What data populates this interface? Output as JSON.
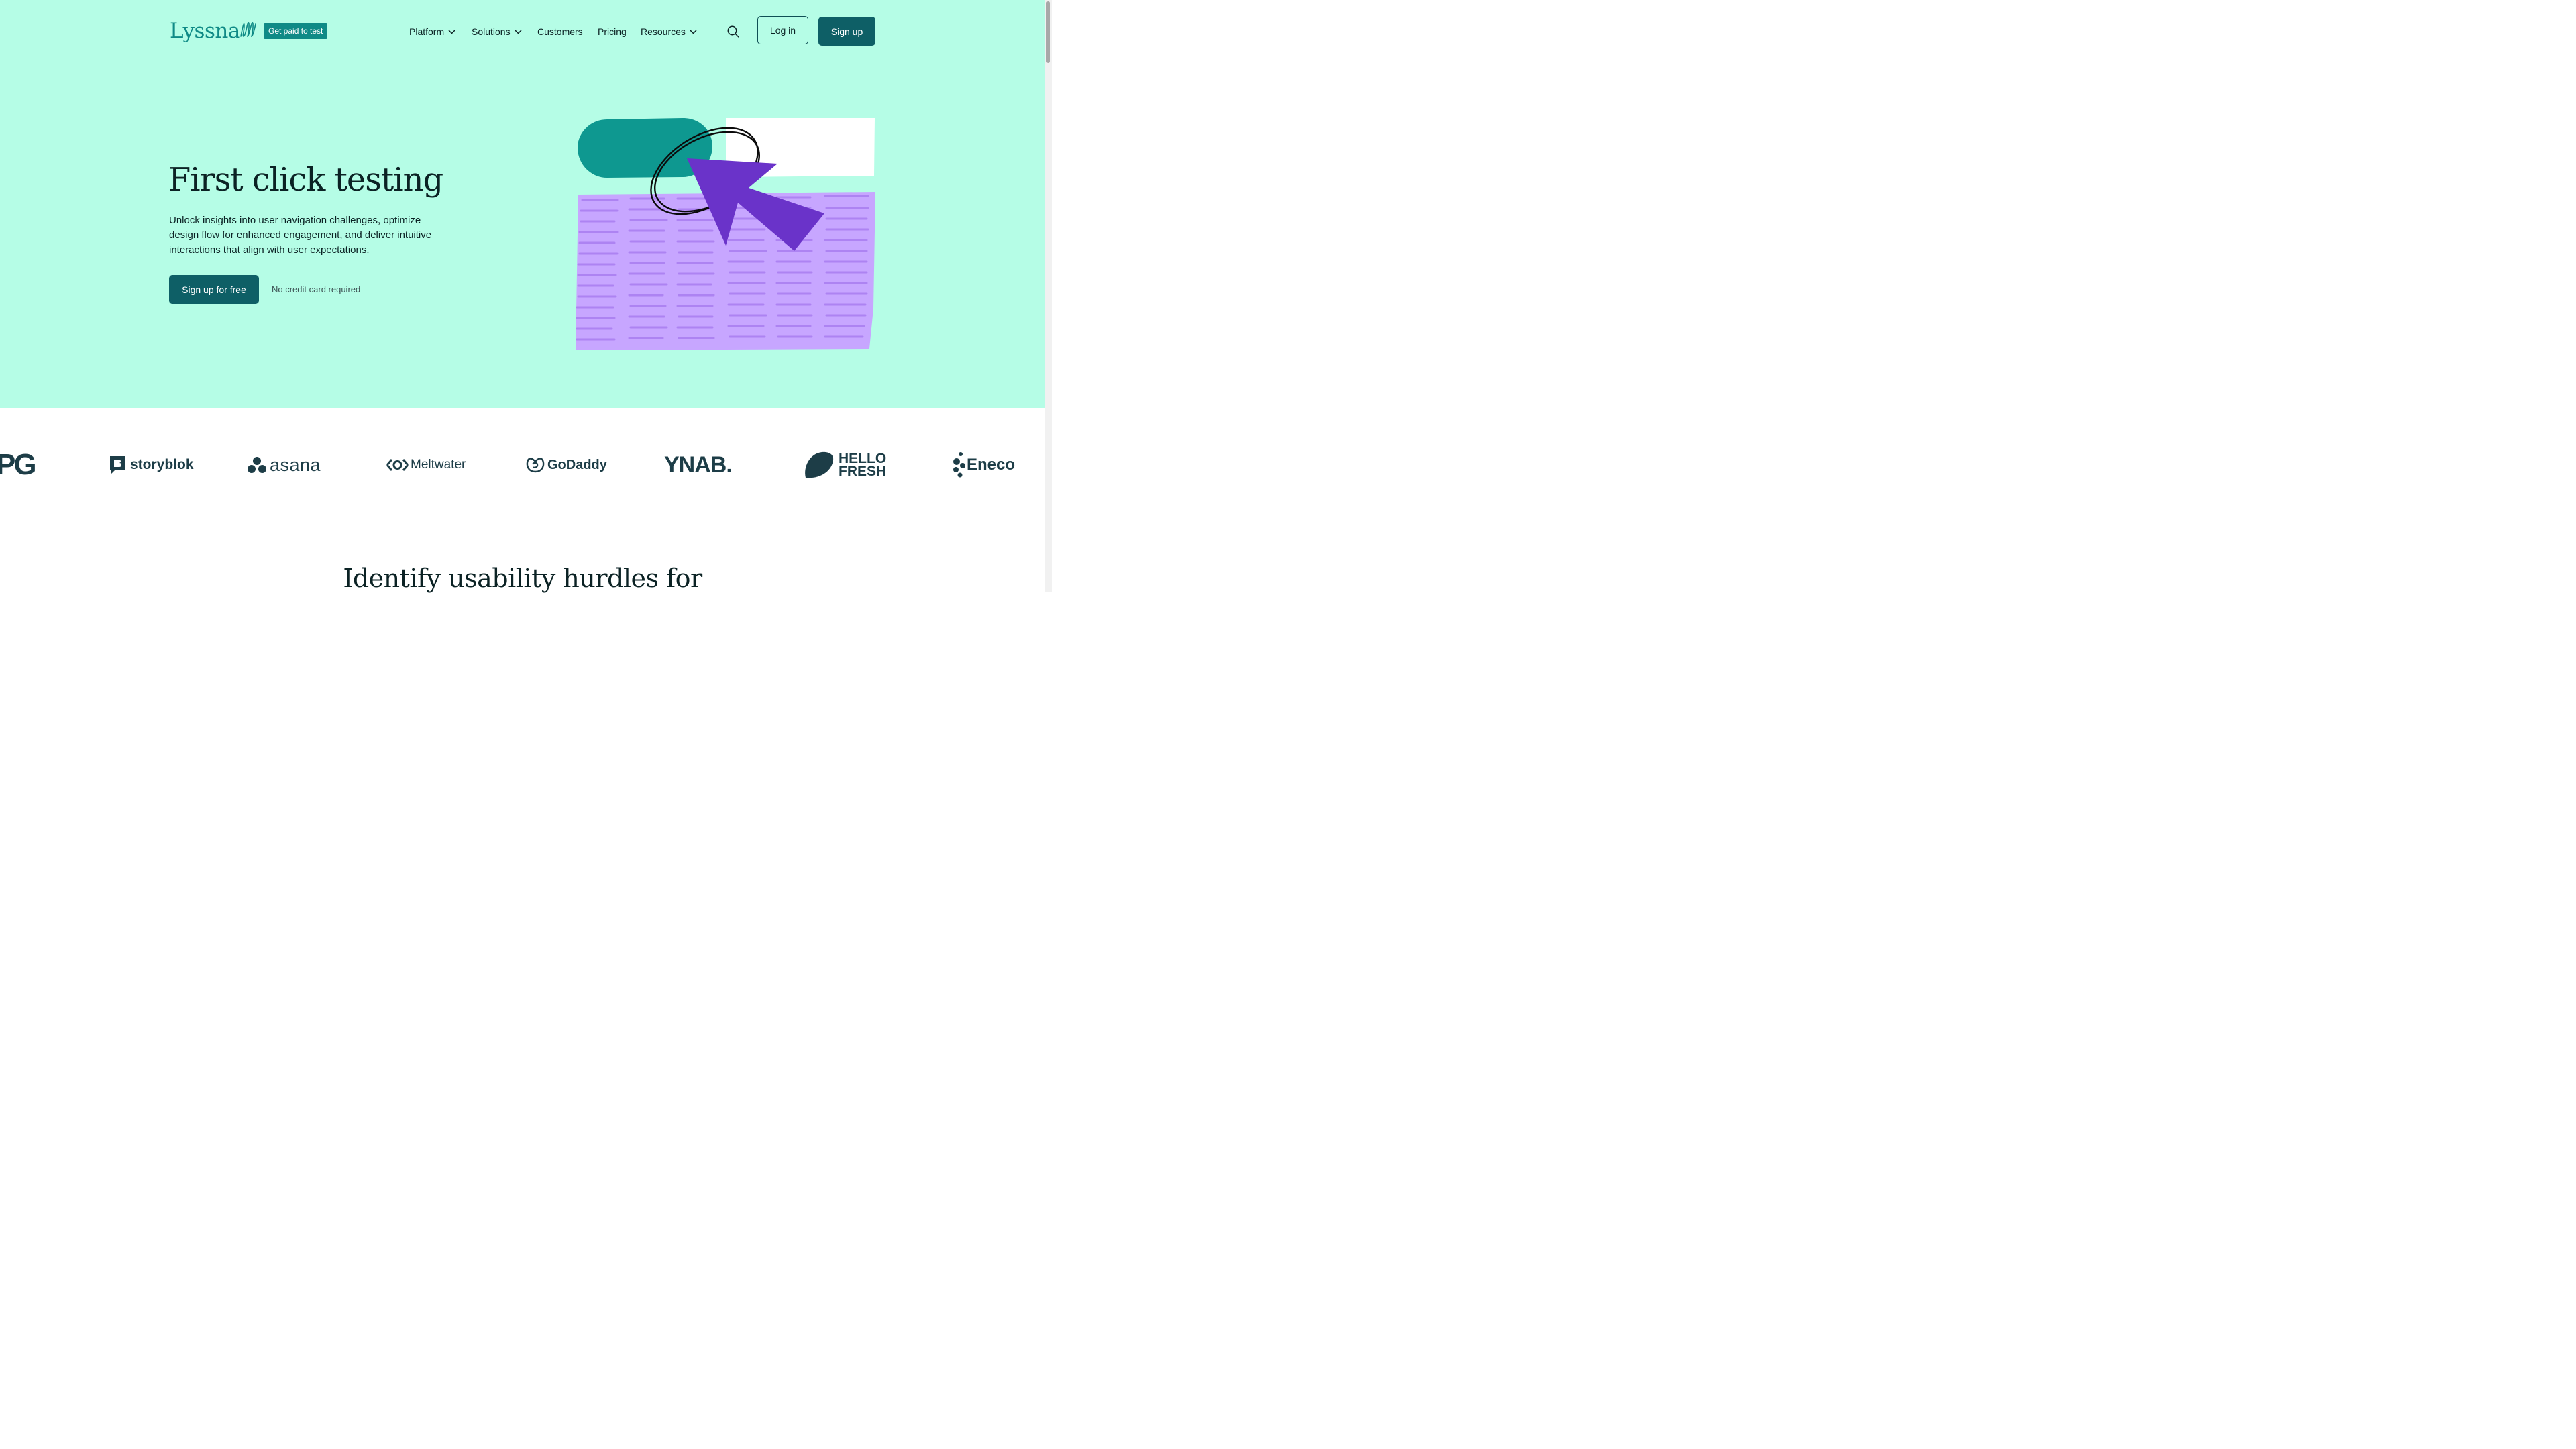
{
  "header": {
    "logo_text": "Lyssna",
    "badge": "Get paid to test",
    "nav": [
      {
        "label": "Platform"
      },
      {
        "label": "Solutions"
      },
      {
        "label": "Customers"
      },
      {
        "label": "Pricing"
      },
      {
        "label": "Resources"
      }
    ],
    "search_icon": "search-icon",
    "login_label": "Log in",
    "signup_label": "Sign up"
  },
  "hero": {
    "title": "First click testing",
    "description": "Unlock insights into user navigation challenges, optimize design flow for enhanced engagement, and deliver intuitive interactions that align with user expectations.",
    "cta_label": "Sign up for free",
    "cta_note": "No credit card required"
  },
  "logos": [
    {
      "name": "PG"
    },
    {
      "name": "storyblok"
    },
    {
      "name": "asana"
    },
    {
      "name": "Meltwater"
    },
    {
      "name": "GoDaddy"
    },
    {
      "name": "YNAB."
    },
    {
      "name": "HELLO FRESH"
    },
    {
      "name": "Eneco"
    }
  ],
  "section": {
    "title": "Identify usability hurdles for"
  },
  "colors": {
    "hero_bg": "#b5fde6",
    "primary": "#0e5f66",
    "teal": "#0f8a86",
    "purple": "#6a33c9",
    "lavender": "#c7a6ff"
  }
}
